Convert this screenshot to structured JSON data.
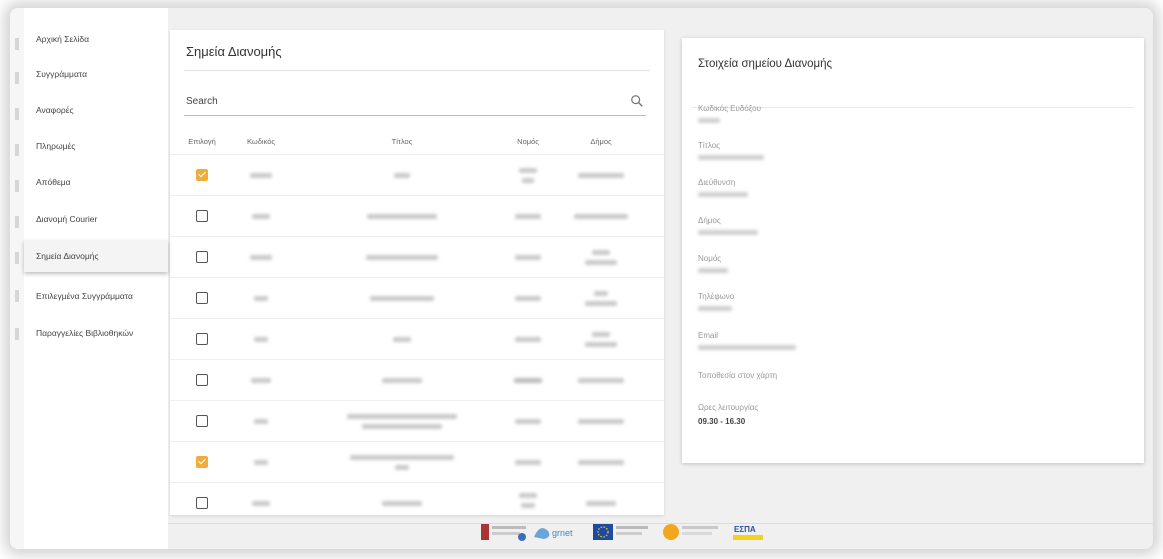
{
  "sidebar": {
    "items": [
      {
        "label": "Αρχική Σελίδα",
        "active": false
      },
      {
        "label": "Συγγράμματα",
        "active": false
      },
      {
        "label": "Αναφορές",
        "active": false
      },
      {
        "label": "Πληρωμές",
        "active": false
      },
      {
        "label": "Απόθεμα",
        "active": false
      },
      {
        "label": "Διανομή Courier",
        "active": false
      },
      {
        "label": "Σημεία Διανομής",
        "active": true
      },
      {
        "label": "Επιλεγμένα Συγγράμματα",
        "active": false
      },
      {
        "label": "Παραγγελίες Βιβλιοθηκών",
        "active": false
      }
    ]
  },
  "list": {
    "title": "Σημεία Διανομής",
    "search_label": "Search",
    "search_icon": "search-icon",
    "columns": [
      "Επιλογή",
      "Κωδικός",
      "Τίτλος",
      "Νομός",
      "Δήμος"
    ],
    "rows": [
      {
        "checked": true
      },
      {
        "checked": false
      },
      {
        "checked": false
      },
      {
        "checked": false
      },
      {
        "checked": false
      },
      {
        "checked": false
      },
      {
        "checked": false
      },
      {
        "checked": true
      },
      {
        "checked": false
      }
    ],
    "checked_color": "#f0ad3c"
  },
  "details": {
    "title": "Στοιχεία σημείου Διανομής",
    "fields": [
      {
        "label": "Κωδικός Ευδόξου",
        "value": ""
      },
      {
        "label": "Τίτλος",
        "value": ""
      },
      {
        "label": "Διεύθυνση",
        "value": ""
      },
      {
        "label": "Δήμος",
        "value": ""
      },
      {
        "label": "Νομός",
        "value": ""
      },
      {
        "label": "Τηλέφωνο",
        "value": ""
      },
      {
        "label": "Email",
        "value": ""
      },
      {
        "label": "Τοποθεσία στον χάρτη",
        "value": ""
      },
      {
        "label": "Ωρες λειτουργίας",
        "value": "09.30 - 16.30"
      }
    ]
  },
  "footer": {
    "logo_text_grnet": "grnet",
    "logo_text_espa": "ΕΣΠΑ"
  }
}
